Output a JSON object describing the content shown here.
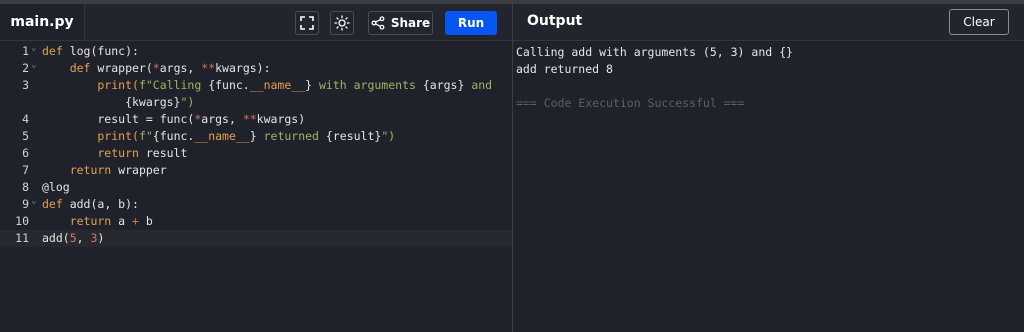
{
  "editor": {
    "file_tab": "main.py",
    "share_label": "Share",
    "run_label": "Run",
    "lines": [
      {
        "n": "1",
        "fold": true,
        "tokens": [
          {
            "t": "def ",
            "c": "kw"
          },
          {
            "t": "log(func):",
            "c": "fn"
          }
        ]
      },
      {
        "n": "2",
        "fold": true,
        "tokens": [
          {
            "t": "    def ",
            "c": "kw"
          },
          {
            "t": "wrapper(",
            "c": "fn"
          },
          {
            "t": "*",
            "c": "op"
          },
          {
            "t": "args, ",
            "c": "fn"
          },
          {
            "t": "**",
            "c": "op"
          },
          {
            "t": "kwargs):",
            "c": "fn"
          }
        ]
      },
      {
        "n": "3",
        "fold": false,
        "tokens": [
          {
            "t": "        print(",
            "c": "kw"
          },
          {
            "t": "f\"Calling ",
            "c": "str"
          },
          {
            "t": "{func.",
            "c": "fn"
          },
          {
            "t": "__name__",
            "c": "kw"
          },
          {
            "t": "}",
            "c": "fn"
          },
          {
            "t": " with arguments ",
            "c": "str"
          },
          {
            "t": "{args}",
            "c": "fn"
          },
          {
            "t": " and",
            "c": "str"
          }
        ]
      },
      {
        "n": "",
        "fold": false,
        "tokens": [
          {
            "t": "            {kwargs}",
            "c": "fn"
          },
          {
            "t": "\")",
            "c": "str"
          }
        ]
      },
      {
        "n": "4",
        "fold": false,
        "tokens": [
          {
            "t": "        result = func(",
            "c": "fn"
          },
          {
            "t": "*",
            "c": "op"
          },
          {
            "t": "args, ",
            "c": "fn"
          },
          {
            "t": "**",
            "c": "op"
          },
          {
            "t": "kwargs)",
            "c": "fn"
          }
        ]
      },
      {
        "n": "5",
        "fold": false,
        "tokens": [
          {
            "t": "        print(",
            "c": "kw"
          },
          {
            "t": "f\"",
            "c": "str"
          },
          {
            "t": "{func.",
            "c": "fn"
          },
          {
            "t": "__name__",
            "c": "kw"
          },
          {
            "t": "}",
            "c": "fn"
          },
          {
            "t": " returned ",
            "c": "str"
          },
          {
            "t": "{result}",
            "c": "fn"
          },
          {
            "t": "\")",
            "c": "str"
          }
        ]
      },
      {
        "n": "6",
        "fold": false,
        "tokens": [
          {
            "t": "        return ",
            "c": "kw"
          },
          {
            "t": "result",
            "c": "fn"
          }
        ]
      },
      {
        "n": "7",
        "fold": false,
        "tokens": [
          {
            "t": "    return ",
            "c": "kw"
          },
          {
            "t": "wrapper",
            "c": "fn"
          }
        ]
      },
      {
        "n": "8",
        "fold": false,
        "tokens": [
          {
            "t": "@log",
            "c": "dec"
          }
        ]
      },
      {
        "n": "9",
        "fold": true,
        "tokens": [
          {
            "t": "def ",
            "c": "kw"
          },
          {
            "t": "add(a, b):",
            "c": "fn"
          }
        ]
      },
      {
        "n": "10",
        "fold": false,
        "tokens": [
          {
            "t": "    return ",
            "c": "kw"
          },
          {
            "t": "a ",
            "c": "fn"
          },
          {
            "t": "+",
            "c": "op"
          },
          {
            "t": " b",
            "c": "fn"
          }
        ]
      },
      {
        "n": "11",
        "fold": false,
        "active": true,
        "tokens": [
          {
            "t": "add(",
            "c": "fn"
          },
          {
            "t": "5",
            "c": "num"
          },
          {
            "t": ", ",
            "c": "fn"
          },
          {
            "t": "3",
            "c": "num"
          },
          {
            "t": ")",
            "c": "fn"
          }
        ]
      }
    ]
  },
  "output": {
    "title": "Output",
    "clear_label": "Clear",
    "lines": [
      {
        "text": "Calling add with arguments (5, 3) and {}",
        "kind": "normal"
      },
      {
        "text": "add returned 8",
        "kind": "normal"
      },
      {
        "text": "",
        "kind": "normal"
      },
      {
        "text": "=== Code Execution Successful ===",
        "kind": "success"
      }
    ]
  },
  "icons": {
    "fullscreen": "fullscreen-icon",
    "theme": "sun-icon",
    "share": "share-icon",
    "fold": "chevron-down-icon"
  },
  "colors": {
    "run_button": "#0556f3",
    "keyword": "#e3a04f",
    "string": "#a6b062",
    "number": "#d47a5a"
  }
}
